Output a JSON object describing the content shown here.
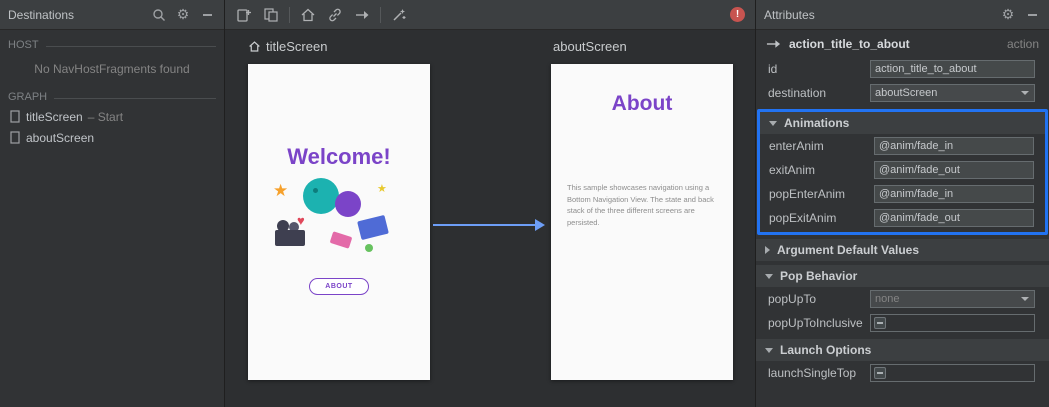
{
  "left": {
    "title": "Destinations",
    "host_label": "HOST",
    "host_empty": "No NavHostFragments found",
    "graph_label": "GRAPH",
    "graph_items": [
      {
        "name": "titleScreen",
        "suffix": "– Start"
      },
      {
        "name": "aboutScreen",
        "suffix": ""
      }
    ]
  },
  "canvas": {
    "title_screen": {
      "label": "titleScreen",
      "heading": "Welcome!",
      "button_label": "ABOUT"
    },
    "about_screen": {
      "label": "aboutScreen",
      "heading": "About",
      "body": "This sample showcases navigation using a Bottom Navigation View. The state and back stack of the three different screens are persisted."
    }
  },
  "attributes": {
    "title": "Attributes",
    "action_name": "action_title_to_about",
    "action_kind": "action",
    "id_label": "id",
    "id_value": "action_title_to_about",
    "destination_label": "destination",
    "destination_value": "aboutScreen",
    "animations": {
      "title": "Animations",
      "rows": [
        {
          "label": "enterAnim",
          "value": "@anim/fade_in"
        },
        {
          "label": "exitAnim",
          "value": "@anim/fade_out"
        },
        {
          "label": "popEnterAnim",
          "value": "@anim/fade_in"
        },
        {
          "label": "popExitAnim",
          "value": "@anim/fade_out"
        }
      ]
    },
    "argument_section_title": "Argument Default Values",
    "pop_section_title": "Pop Behavior",
    "popupto_label": "popUpTo",
    "popupto_value": "none",
    "popuptoinclusive_label": "popUpToInclusive",
    "launch_section_title": "Launch Options",
    "launchsingletop_label": "launchSingleTop"
  },
  "icons": {
    "gear": "⚙",
    "star": "★",
    "heart": "♥"
  },
  "colors": {
    "accent_purple": "#7b44c8",
    "highlight_blue": "#2273f2",
    "arrow_blue": "#6d9ef7",
    "error_red": "#c75450",
    "panel_bg": "#313335",
    "header_bg": "#3c3f41"
  }
}
